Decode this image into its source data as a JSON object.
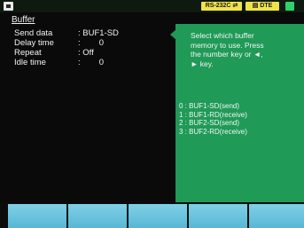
{
  "status_bar": {
    "left_icon": "screen-icon",
    "rs_badge": "RS-232C",
    "rs_icon": "cable-icon",
    "dte_badge": "DTE",
    "dte_icon": "dte-icon",
    "right_icon": "status-green-icon"
  },
  "panel": {
    "title": "Buffer",
    "settings": [
      {
        "label": "Send data",
        "value": ": BUF1-SD"
      },
      {
        "label": "Delay time",
        "value": ":        0"
      },
      {
        "label": "Repeat",
        "value": ": Off"
      },
      {
        "label": "Idle time",
        "value": ":        0"
      }
    ]
  },
  "help": {
    "text_lines": [
      "Select which buffer",
      "memory to use. Press",
      "the number key or ◄,",
      "► key."
    ],
    "options": [
      "0 : BUF1-SD(send)",
      "1 : BUF1-RD(receive)",
      "2 : BUF2-SD(send)",
      "3 : BUF2-RD(receive)"
    ]
  },
  "function_keys": [
    "",
    "",
    "",
    "",
    ""
  ],
  "colors": {
    "background": "#0a0a0a",
    "help_panel": "#1f9a57",
    "function_key": "#6cc4de",
    "badge": "#f0e34a"
  }
}
